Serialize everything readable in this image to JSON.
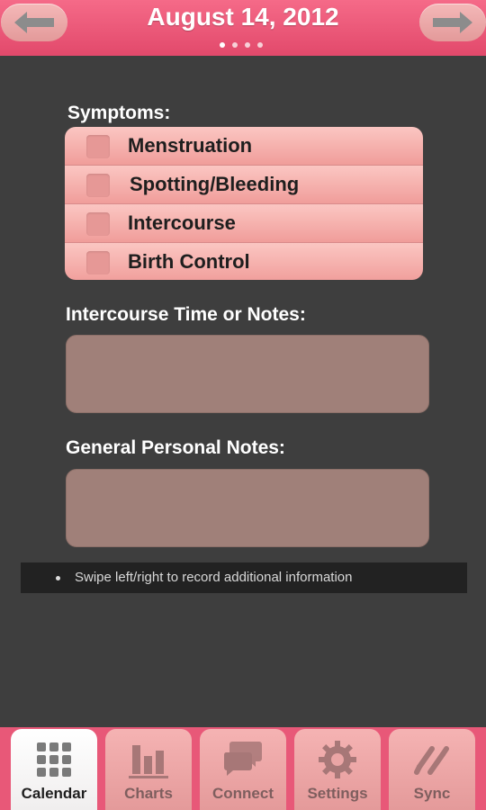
{
  "header": {
    "title": "August 14, 2012",
    "prev_icon": "arrow-left-icon",
    "next_icon": "arrow-right-icon",
    "page_indicator": {
      "pages": 4,
      "current": 1
    }
  },
  "symptoms": {
    "label": "Symptoms:",
    "items": [
      {
        "label": "Menstruation",
        "checked": false
      },
      {
        "label": "Spotting/Bleeding",
        "checked": false
      },
      {
        "label": "Intercourse",
        "checked": false
      },
      {
        "label": "Birth Control",
        "checked": false
      }
    ]
  },
  "intercourse_notes": {
    "label": "Intercourse Time or Notes:",
    "value": ""
  },
  "general_notes": {
    "label": "General Personal Notes:",
    "value": ""
  },
  "hint": "Swipe left/right to record additional information",
  "tabs": [
    {
      "label": "Calendar",
      "icon": "calendar-grid-icon",
      "active": true
    },
    {
      "label": "Charts",
      "icon": "bar-chart-icon",
      "active": false
    },
    {
      "label": "Connect",
      "icon": "chat-bubbles-icon",
      "active": false
    },
    {
      "label": "Settings",
      "icon": "gear-icon",
      "active": false
    },
    {
      "label": "Sync",
      "icon": "sync-link-icon",
      "active": false
    }
  ],
  "colors": {
    "header": "#e2496b",
    "background": "#3e3e3e",
    "symptom_row": "#f4aeab",
    "notes_box": "#a08079",
    "tabbar": "#e85878"
  }
}
